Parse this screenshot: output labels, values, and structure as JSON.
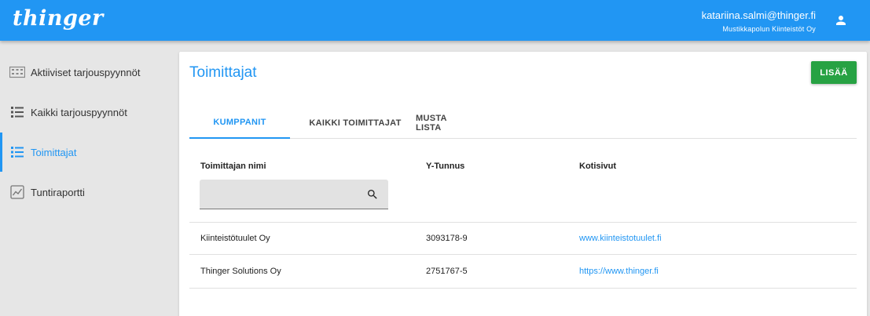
{
  "header": {
    "logo_text": "thinger",
    "user_email": "katariina.salmi@thinger.fi",
    "user_org": "Mustikkapolun Kiinteistöt Oy",
    "user_icon": "person-icon",
    "bg_color": "#2196f3"
  },
  "sidebar": {
    "items": [
      {
        "label": "Aktiiviset tarjouspyynnöt",
        "icon": "building-icon"
      },
      {
        "label": "Kaikki tarjouspyynnöt",
        "icon": "list-icon"
      },
      {
        "label": "Toimittajat",
        "icon": "list-icon",
        "active": true
      },
      {
        "label": "Tuntiraportti",
        "icon": "chart-icon"
      }
    ]
  },
  "main": {
    "title": "Toimittajat",
    "add_button": "LISÄÄ",
    "tabs": [
      {
        "label": "KUMPPANIT",
        "active": true
      },
      {
        "label": "KAIKKI TOIMITTAJAT"
      },
      {
        "label": "MUSTA LISTA"
      }
    ],
    "columns": [
      "Toimittajan nimi",
      "Y-Tunnus",
      "Kotisivut"
    ],
    "search": {
      "value": "",
      "icon": "search-icon"
    },
    "rows": [
      {
        "name": "Kiinteistötuulet Oy",
        "ytunnus": "3093178-9",
        "website": "www.kiinteistotuulet.fi"
      },
      {
        "name": "Thinger Solutions Oy",
        "ytunnus": "2751767-5",
        "website": "https://www.thinger.fi"
      }
    ]
  },
  "colors": {
    "accent": "#2196f3",
    "add_button": "#27a243",
    "sidebar_bg": "#e6e6e6"
  }
}
